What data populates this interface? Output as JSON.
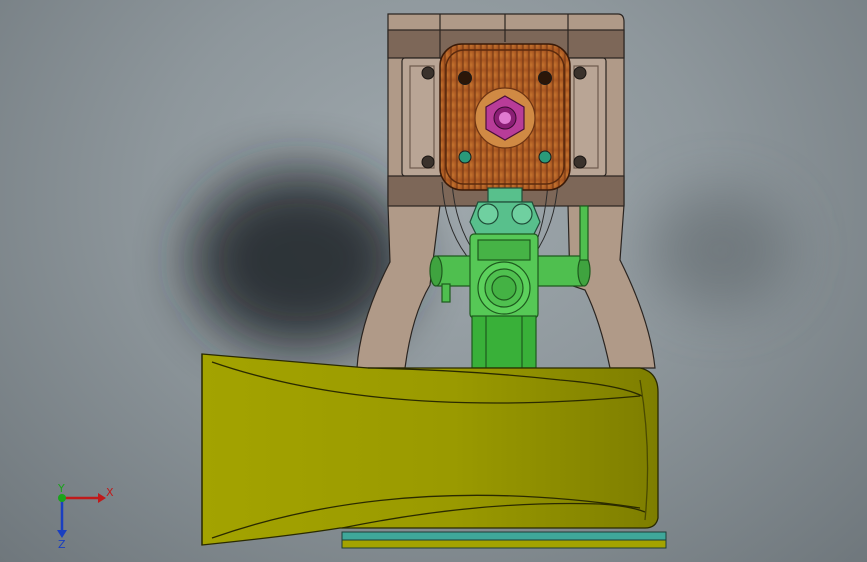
{
  "viewport": {
    "background": "#8e979c"
  },
  "model": {
    "colors": {
      "bracket": "#b09a88",
      "bracket_dark": "#7d6758",
      "cylinder_head": "#b9632a",
      "cylinder_head_dark": "#6e3412",
      "nut": "#c8419e",
      "nut_hole": "#e07ad0",
      "crankcase": "#58c08c",
      "crankcase_dark": "#2c6e50",
      "mount_tube": "#39b039",
      "mount_tube_dark": "#1d6e1d",
      "cowl": "#9a9a00",
      "cowl_dark": "#5a5a00",
      "base_strip": "#3fa79a"
    }
  },
  "triad": {
    "x_label": "X",
    "y_label": "Y",
    "z_label": "Z",
    "x_color": "#c01a1a",
    "y_color": "#1aa31a",
    "z_color": "#1a3fc0"
  }
}
